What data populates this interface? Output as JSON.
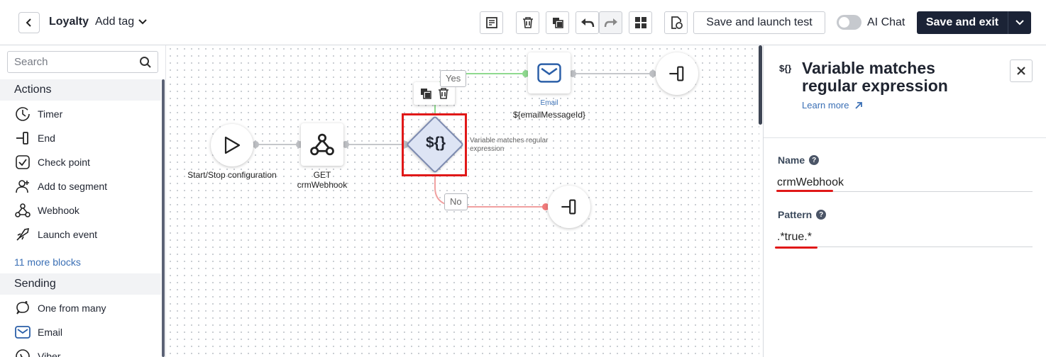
{
  "header": {
    "breadcrumb": "Loyalty",
    "tag_dropdown": "Add tag",
    "launch_button": "Save and launch test",
    "ai_chat_label": "AI Chat",
    "ai_chat_enabled": false,
    "save_exit_button": "Save and exit"
  },
  "sidebar": {
    "search_placeholder": "Search",
    "actions_title": "Actions",
    "actions": [
      {
        "label": "Timer",
        "icon": "timer-icon"
      },
      {
        "label": "End",
        "icon": "end-icon"
      },
      {
        "label": "Check point",
        "icon": "checkpoint-icon"
      },
      {
        "label": "Add to segment",
        "icon": "segment-icon"
      },
      {
        "label": "Webhook",
        "icon": "webhook-icon"
      },
      {
        "label": "Launch event",
        "icon": "rocket-icon"
      }
    ],
    "more_blocks": "11 more blocks",
    "sending_title": "Sending",
    "sending": [
      {
        "label": "One from many",
        "icon": "one-from-many-icon"
      },
      {
        "label": "Email",
        "icon": "email-icon"
      },
      {
        "label": "Viber",
        "icon": "viber-icon"
      }
    ]
  },
  "canvas": {
    "start_label": "Start/Stop configuration",
    "webhook_label_1": "GET",
    "webhook_label_2": "crmWebhook",
    "condition_symbol": "${}",
    "condition_label": "Variable matches regular expression",
    "yes_label": "Yes",
    "no_label": "No",
    "email_small": "Email",
    "email_label": "${emailMessageId}"
  },
  "panel": {
    "icon_text": "${}",
    "title": "Variable matches regular expression",
    "learn_more": "Learn more",
    "name_label": "Name",
    "name_value": "crmWebhook",
    "pattern_label": "Pattern",
    "pattern_value": ".*true.*"
  },
  "colors": {
    "yes_line": "#8fd98f",
    "no_line": "#f0a0a0",
    "highlight": "#e01818",
    "dark_button": "#1b2336",
    "link": "#3a6fb5"
  }
}
